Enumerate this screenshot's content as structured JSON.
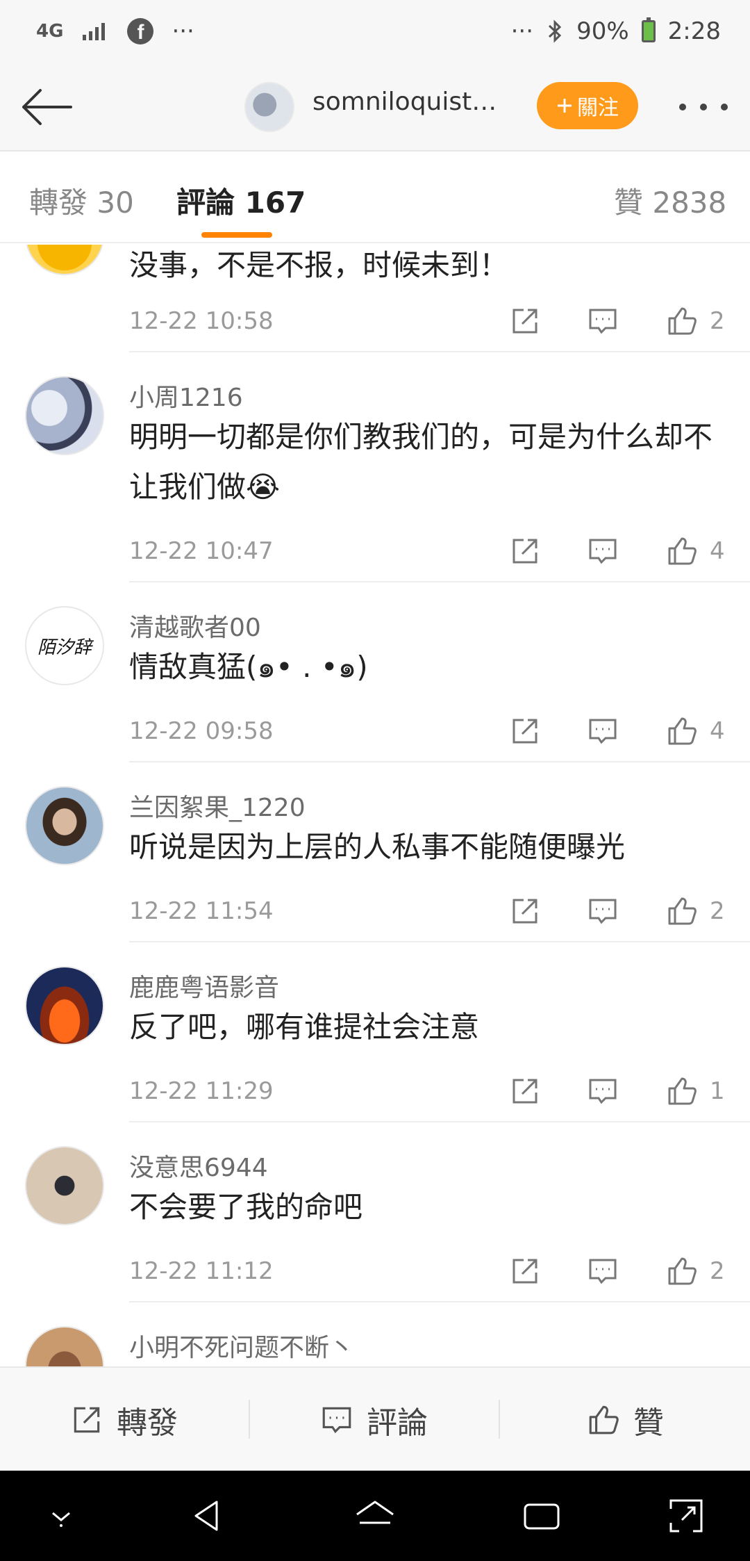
{
  "status_bar": {
    "network": "4G",
    "ellipsis_left": "···",
    "ellipsis_right": "···",
    "battery_percent": "90%",
    "time": "2:28"
  },
  "header": {
    "username": "somniloquist_...",
    "follow_label": "關注"
  },
  "tabs": [
    {
      "label": "轉發 30"
    },
    {
      "label": "評論 167"
    },
    {
      "label": "贊 2838"
    }
  ],
  "comments": [
    {
      "name": "",
      "text": "没事，不是不报，时候未到！",
      "time": "12-22 10:58",
      "likes": "2"
    },
    {
      "name": "小周1216",
      "text": "明明一切都是你们教我们的，可是为什么却不让我们做😭",
      "time": "12-22 10:47",
      "likes": "4"
    },
    {
      "name": "清越歌者00",
      "text": "情敌真猛(๑• . •๑)",
      "time": "12-22 09:58",
      "likes": "4",
      "avatar_text": "陌汐辞"
    },
    {
      "name": "兰因絮果_1220",
      "text": "听说是因为上层的人私事不能随便曝光",
      "time": "12-22 11:54",
      "likes": "2"
    },
    {
      "name": "鹿鹿粤语影音",
      "text": "反了吧，哪有谁提社会注意",
      "time": "12-22 11:29",
      "likes": "1"
    },
    {
      "name": "没意思6944",
      "text": "不会要了我的命吧",
      "time": "12-22 11:12",
      "likes": "2"
    },
    {
      "name": "小明不死问题不断丶",
      "text": "",
      "time": "",
      "likes": ""
    }
  ],
  "bottom_bar": {
    "repost": "轉發",
    "comment": "評論",
    "like": "贊"
  },
  "colors": {
    "accent": "#ff8200",
    "follow_button": "#ff9a1a",
    "name_gray": "#6b6b6b"
  },
  "icons": [
    "back-arrow-icon",
    "facebook-icon",
    "bluetooth-icon",
    "battery-icon",
    "repost-icon",
    "comment-icon",
    "like-icon"
  ]
}
